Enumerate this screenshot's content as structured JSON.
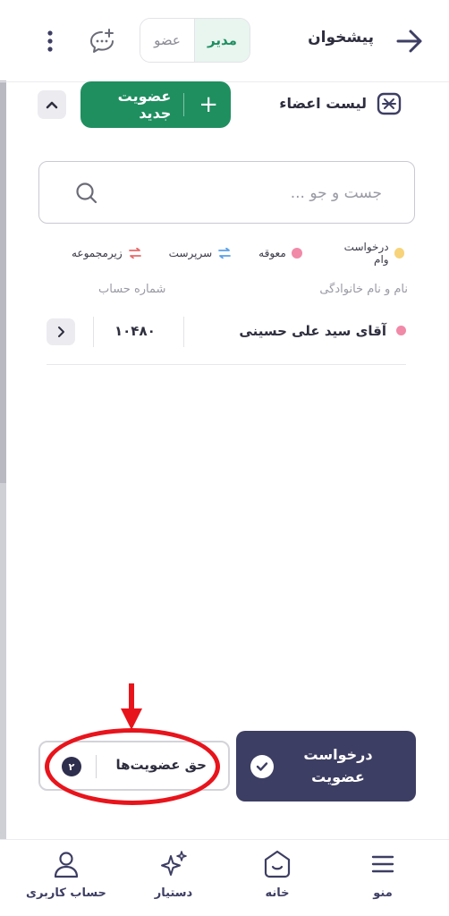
{
  "header": {
    "title": "پیشخوان",
    "role_member": "عضو",
    "role_admin": "مدیر"
  },
  "members": {
    "title": "لیست اعضاء",
    "new_member_label": "عضویت جدید"
  },
  "search": {
    "placeholder": "جست و جو ..."
  },
  "legend": [
    {
      "label": "درخواست وام",
      "color": "#f7d37a"
    },
    {
      "label": "معوقه",
      "color": "#f08aa8"
    },
    {
      "label": "سرپرست"
    },
    {
      "label": "زیرمجموعه"
    }
  ],
  "table": {
    "col_name": "نام و نام خانوادگی",
    "col_account": "شماره حساب",
    "rows": [
      {
        "name": "آقای سید علی حسینی",
        "account": "۱۰۴۸۰"
      }
    ]
  },
  "actions": {
    "membership_fees_label": "حق عضویت‌ها",
    "membership_fees_count": "۲",
    "request_membership_label": "درخواست عضویت"
  },
  "nav": {
    "menu": "منو",
    "home": "خانه",
    "assistant": "دستیار",
    "account": "حساب کاربری"
  }
}
